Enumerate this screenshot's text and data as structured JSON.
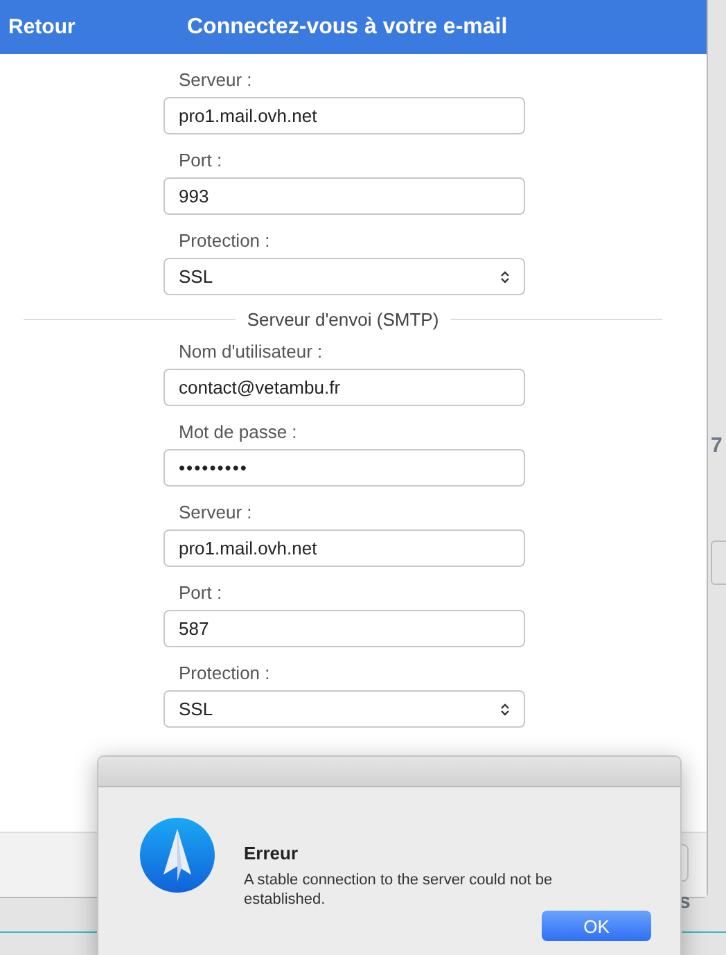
{
  "header": {
    "back": "Retour",
    "title": "Connectez-vous à votre e-mail"
  },
  "incoming": [
    {
      "label": "Serveur :",
      "kind": "text",
      "value": "pro1.mail.ovh.net"
    },
    {
      "label": "Port :",
      "kind": "text",
      "value": "993"
    },
    {
      "label": "Protection :",
      "kind": "select",
      "value": "SSL"
    }
  ],
  "section_title": "Serveur d'envoi (SMTP)",
  "outgoing": [
    {
      "label": "Nom d'utilisateur :",
      "kind": "text",
      "value": "contact@vetambu.fr"
    },
    {
      "label": "Mot de passe :",
      "kind": "password",
      "value": "•••••••••"
    },
    {
      "label": "Serveur :",
      "kind": "text",
      "value": "pro1.mail.ovh.net"
    },
    {
      "label": "Port :",
      "kind": "text",
      "value": "587"
    },
    {
      "label": "Protection :",
      "kind": "select",
      "value": "SSL"
    }
  ],
  "background_fragments": [
    "7",
    "s"
  ],
  "dialog": {
    "title": "Erreur",
    "message": "A stable connection to the server could not be established.",
    "button": "OK"
  }
}
